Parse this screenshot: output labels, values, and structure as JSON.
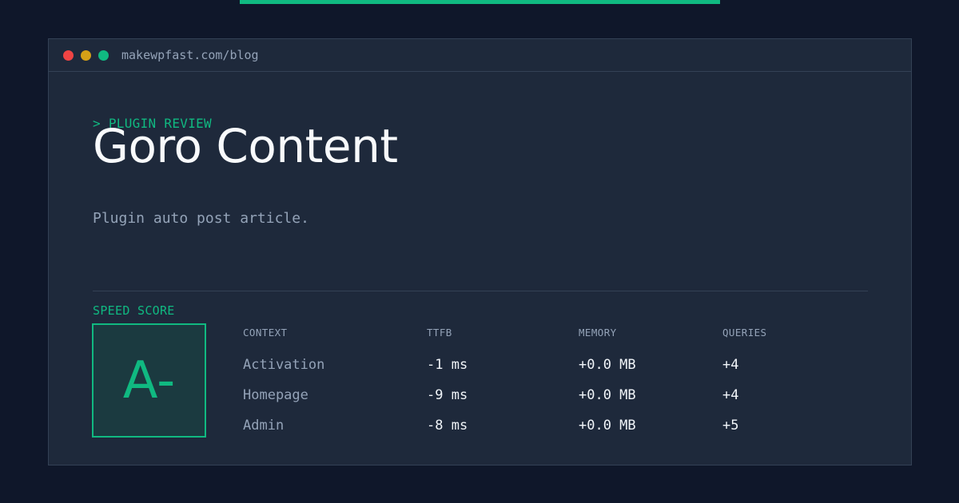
{
  "colors": {
    "background": "#0f172a",
    "window": "#1e293b",
    "accent": "#10b981",
    "dot_red": "#ef4444",
    "dot_yellow": "#eab308",
    "dot_green": "#10b981"
  },
  "window": {
    "url": "makewpfast.com/blog"
  },
  "header": {
    "kicker": "> PLUGIN REVIEW",
    "title": "Goro Content",
    "description": "Plugin auto post article."
  },
  "score": {
    "label": "SPEED SCORE",
    "grade": "A-"
  },
  "metrics": {
    "columns": [
      "CONTEXT",
      "TTFB",
      "MEMORY",
      "QUERIES"
    ],
    "rows": [
      [
        "Activation",
        "-1 ms",
        "+0.0 MB",
        "+4"
      ],
      [
        "Homepage",
        "-9 ms",
        "+0.0 MB",
        "+4"
      ],
      [
        "Admin",
        "-8 ms",
        "+0.0 MB",
        "+5"
      ]
    ]
  }
}
